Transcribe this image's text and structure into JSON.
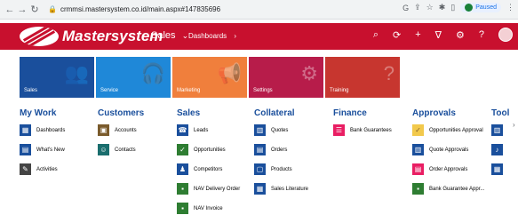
{
  "browser": {
    "url": "crmmsi.mastersystem.co.id/main.aspx#147835696",
    "profile_status": "Paused"
  },
  "topbar": {
    "brand": "Mastersystem",
    "area": "Sales",
    "area_caret": "⌄",
    "breadcrumb": "Dashboards",
    "breadcrumb_caret": "›"
  },
  "tiles": [
    {
      "label": "Sales",
      "color": "#1a4f9c"
    },
    {
      "label": "Service",
      "color": "#1f88d8"
    },
    {
      "label": "Marketing",
      "color": "#f07f3c"
    },
    {
      "label": "Settings",
      "color": "#b71c4a"
    },
    {
      "label": "Training",
      "color": "#c7362f"
    }
  ],
  "columns": {
    "mywork": {
      "title": "My Work",
      "items": [
        "Dashboards",
        "What's New",
        "Activities"
      ]
    },
    "customers": {
      "title": "Customers",
      "items": [
        "Accounts",
        "Contacts"
      ]
    },
    "sales": {
      "title": "Sales",
      "items": [
        "Leads",
        "Opportunities",
        "Competitors",
        "NAV Delivery Order",
        "NAV Invoice"
      ]
    },
    "collateral": {
      "title": "Collateral",
      "items": [
        "Quotes",
        "Orders",
        "Products",
        "Sales Literature"
      ]
    },
    "finance": {
      "title": "Finance",
      "items": [
        "Bank Guarantees"
      ]
    },
    "approvals": {
      "title": "Approvals",
      "items": [
        "Opportunities Approval",
        "Quote Approvals",
        "Order Approvals",
        "Bank Guarantee Appr..."
      ]
    },
    "tools": {
      "title": "Tool"
    }
  }
}
